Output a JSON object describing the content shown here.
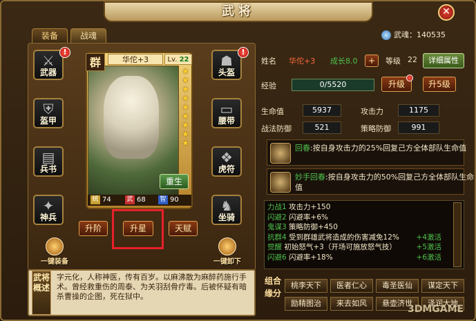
{
  "window": {
    "title": "武将",
    "close_label": "✕"
  },
  "tabs": [
    {
      "label": "装备"
    },
    {
      "label": "战魂"
    }
  ],
  "war_soul": {
    "label": "武魂：140535"
  },
  "equipment_slots": {
    "weapon": {
      "label": "武器",
      "alert": "!"
    },
    "armor": {
      "label": "盔甲"
    },
    "book": {
      "label": "兵书"
    },
    "mount": {
      "label": "神兵"
    },
    "helmet": {
      "label": "头盔",
      "alert": "!"
    },
    "belt": {
      "label": "腰带"
    },
    "tally": {
      "label": "虎符"
    },
    "horse": {
      "label": "坐骑"
    }
  },
  "card": {
    "faction": "群",
    "name": "华佗+3",
    "level_prefix": "Lv.",
    "level": "22",
    "stars": 9,
    "rebirth_label": "重生",
    "stats": {
      "tong_icon": "统",
      "tong": "74",
      "wu_icon": "武",
      "wu": "68",
      "zhi_icon": "智",
      "zhi": "90"
    }
  },
  "actions": {
    "advance": "升阶",
    "star_up": "升星",
    "talent": "天赋"
  },
  "one_key": {
    "equip": "一键装备",
    "unequip": "一键卸下"
  },
  "bio": {
    "tag": "武将概述",
    "text": "字元化，人称神医，传有百岁。以麻沸散为麻醉药施行手术。曾经救重伤的周泰、为关羽刮骨疗毒。后被怀疑有暗杀曹操的企图，死在狱中。"
  },
  "info": {
    "name_label": "姓名",
    "name_value": "华佗+3",
    "growth_label": "成长8.0",
    "growth_add": "+",
    "level_label": "等级",
    "level_value": "22",
    "detail_btn": "详细属性",
    "exp_label": "经验",
    "exp_value": "0/5520",
    "upgrade_btn": "升级",
    "upgrade5_btn": "升5级",
    "hp_label": "生命值",
    "hp_value": "5937",
    "atk_label": "攻击力",
    "atk_value": "1175",
    "def_label": "战法防御",
    "def_value": "521",
    "strat_label": "策略防御",
    "strat_value": "991"
  },
  "skills": [
    {
      "name": "回春",
      "text": ":按自身攻击力的25%回复己方全体部队生命值"
    },
    {
      "name": "妙手回春",
      "text": ":按自身攻击力的50%回复己方全体部队生命值"
    }
  ],
  "bonuses": [
    {
      "k": "力战1",
      "v": "攻击力+150",
      "a": ""
    },
    {
      "k": "闪避2",
      "v": "闪避率+6%",
      "a": ""
    },
    {
      "k": "鬼谋3",
      "v": "策略防御+450",
      "a": ""
    },
    {
      "k": "抗群4",
      "v": "受到群雄武将造成的伤害减免12%",
      "a": "+4激活"
    },
    {
      "k": "觉醒",
      "v": "初始怒气+3（开场可施放怒气技）",
      "a": "+5激活"
    },
    {
      "k": "闪避6",
      "v": "闪避率+18%",
      "a": "+6激活"
    }
  ],
  "combo": {
    "label": "组合缘分",
    "items": [
      "桃李天下",
      "医者仁心",
      "毒圣医仙",
      "谋定天下",
      "励精图治",
      "来去如风",
      "悬壶济世",
      "泽润大地"
    ]
  },
  "watermark": "3DMGAME"
}
